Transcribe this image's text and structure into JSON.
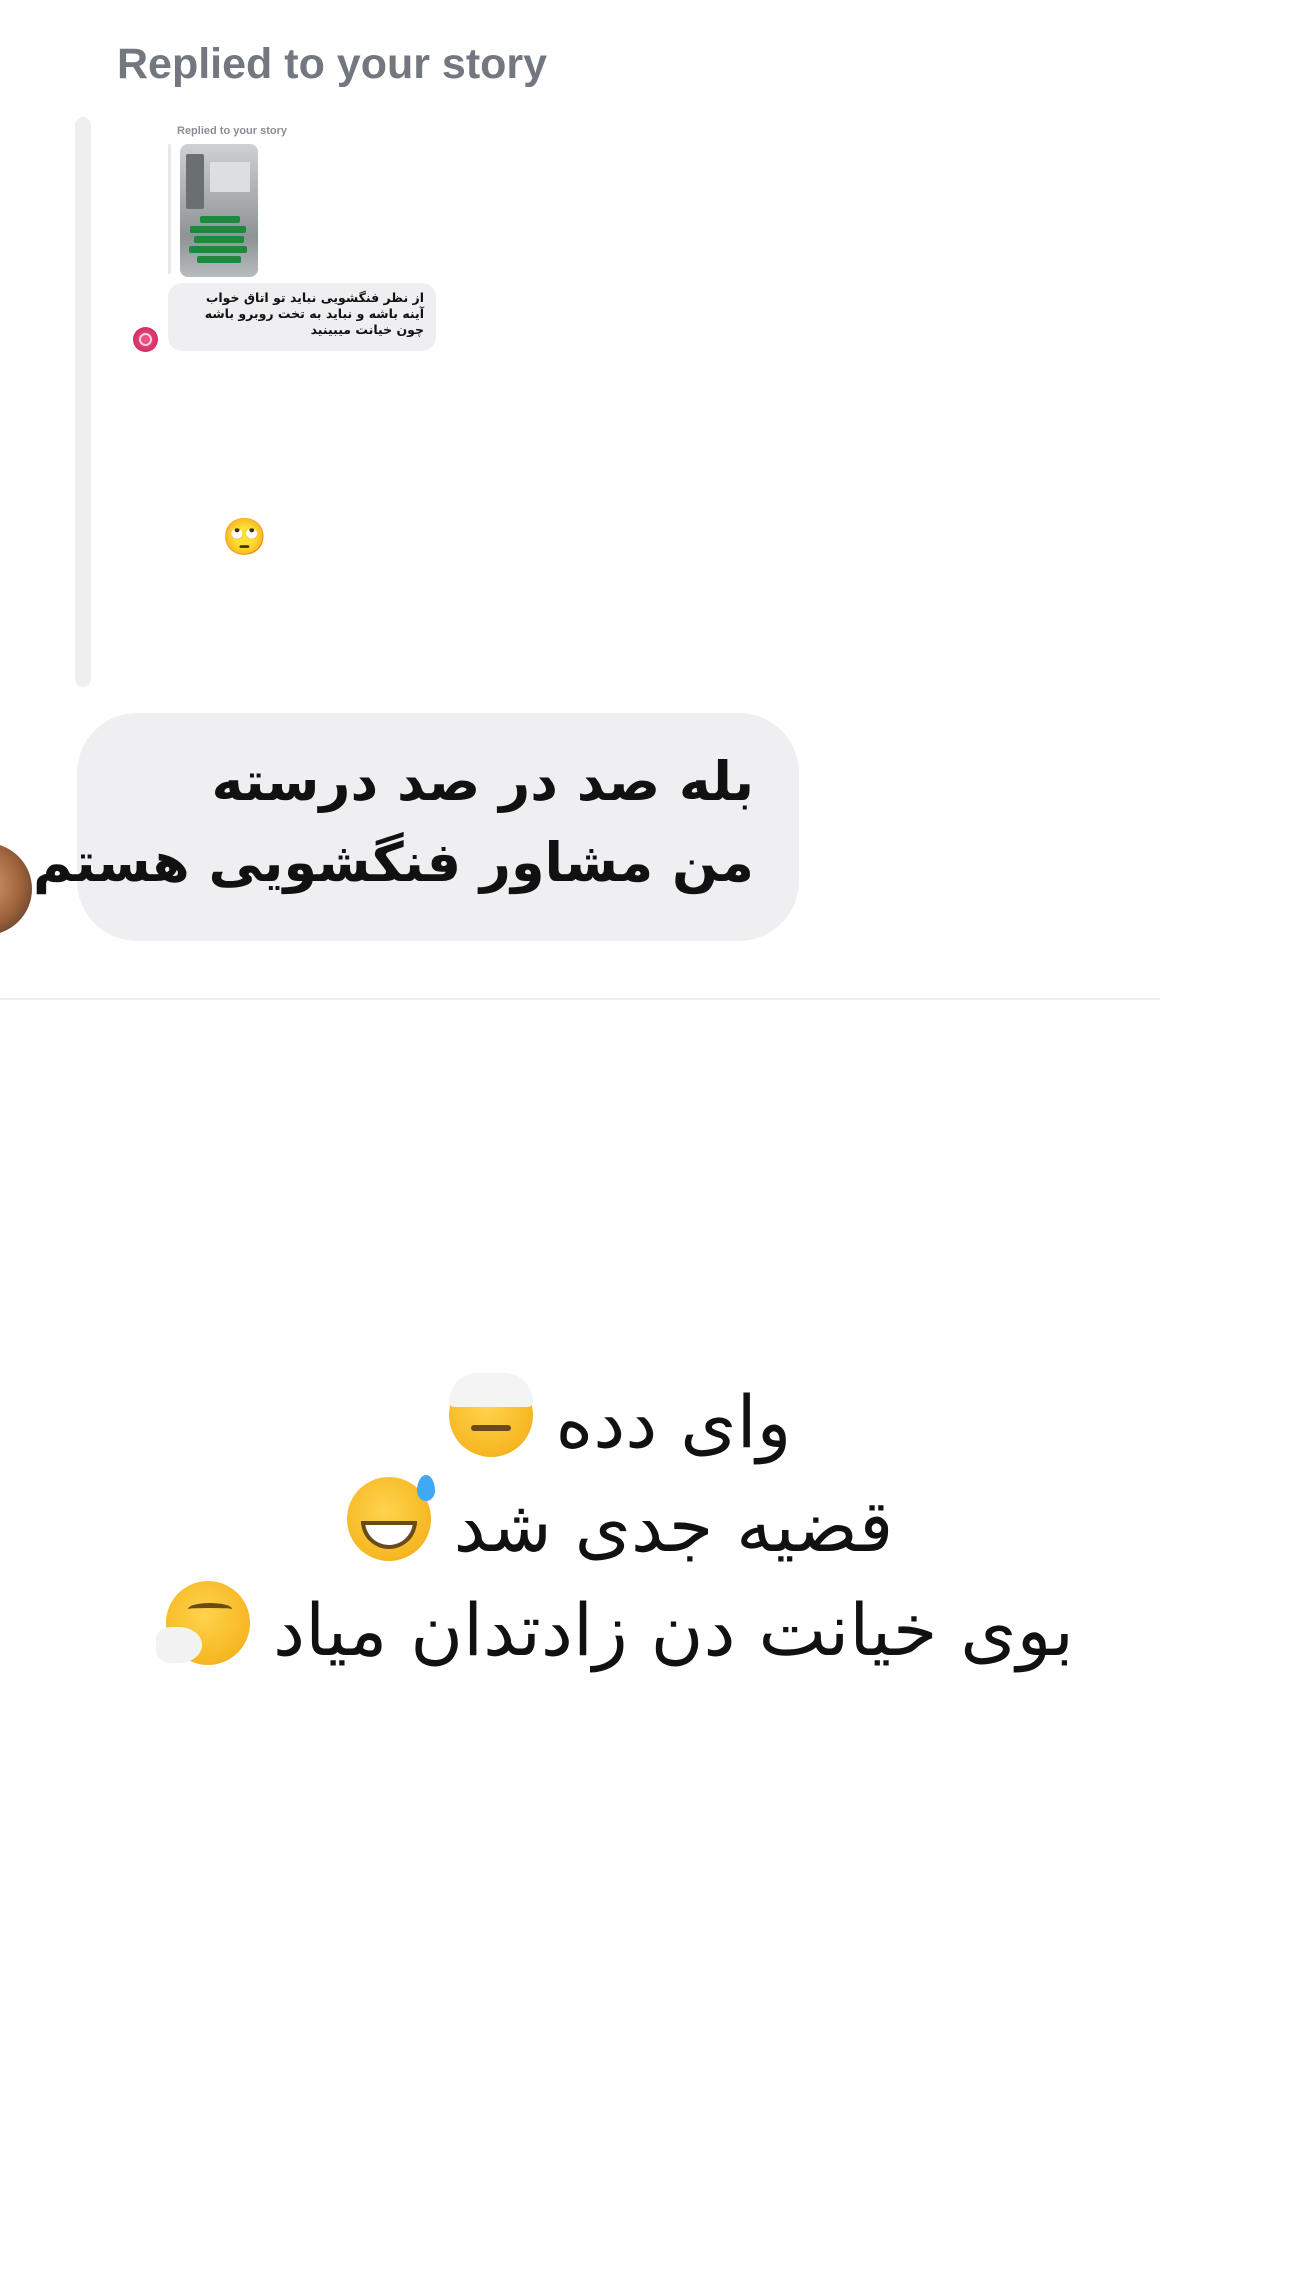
{
  "story_reply": {
    "header": "Replied to your story",
    "mini_header": "Replied to your story",
    "mini_message": "از نظر فنگشویی نباید تو اتاق خواب آینه باشه و نباید به تخت روبرو باشه چون خیانت میبینید",
    "reaction_emoji": "🙄"
  },
  "reply_message": {
    "line1": "بله صد در صد درسته",
    "line2": "من مشاور فنگشویی هستم"
  },
  "caption": {
    "line1_text": "وای دده",
    "line1_emoji": "face-with-head-bandage-icon",
    "line2_text": "قضیه جدی شد",
    "line2_emoji": "grinning-face-with-sweat-icon",
    "line3_text": "بوی خیانت دن زادتدان میاد",
    "line3_emoji": "sneezing-face-icon"
  },
  "colors": {
    "bubble_bg": "#efeff1",
    "header_text": "#737880",
    "message_text": "#111111"
  }
}
